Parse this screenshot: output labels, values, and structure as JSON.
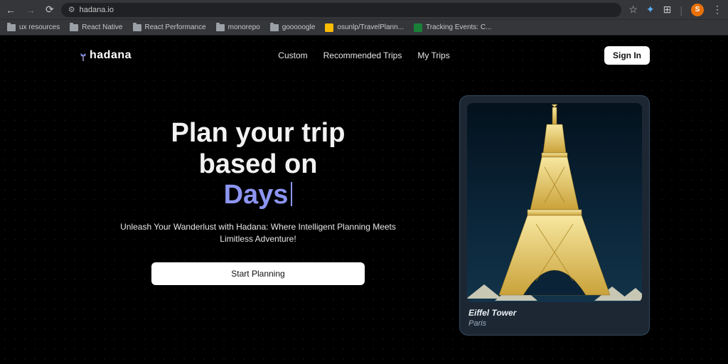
{
  "browser": {
    "url": "hadana.io",
    "bookmarks": [
      {
        "label": "ux resources",
        "type": "folder"
      },
      {
        "label": "React Native",
        "type": "folder"
      },
      {
        "label": "React Performance",
        "type": "folder"
      },
      {
        "label": "monorepo",
        "type": "folder"
      },
      {
        "label": "gooooogle",
        "type": "folder"
      },
      {
        "label": "osunlp/TravelPlann...",
        "type": "fav-yellow"
      },
      {
        "label": "Tracking Events: C...",
        "type": "fav-green"
      }
    ],
    "avatar_initial": "S"
  },
  "header": {
    "brand": "hadana",
    "menu": [
      "Custom",
      "Recommended Trips",
      "My Trips"
    ],
    "signin": "Sign In"
  },
  "hero": {
    "title_line1": "Plan your trip",
    "title_line2": "based on",
    "title_accent": "Days",
    "subtitle": "Unleash Your Wanderlust with Hadana: Where Intelligent Planning Meets Limitless Adventure!",
    "cta": "Start Planning"
  },
  "card": {
    "title": "Eiffel Tower",
    "city": "Paris"
  }
}
